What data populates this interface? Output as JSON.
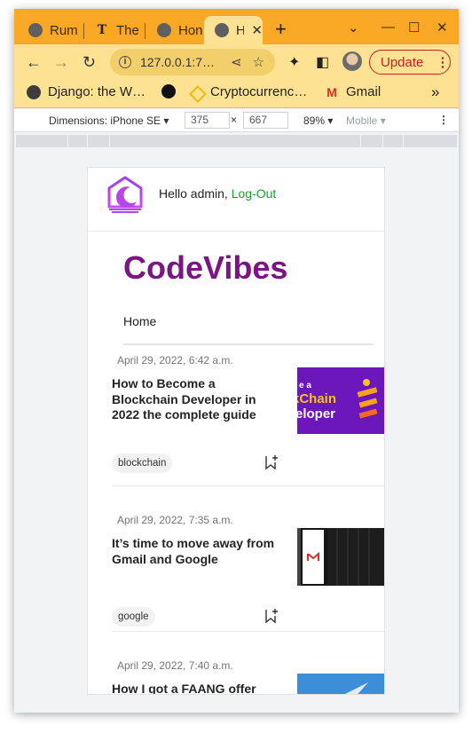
{
  "browser": {
    "tabs": [
      {
        "label": "Rum",
        "icon": "globe-icon"
      },
      {
        "label": "The",
        "icon": "nyt-icon"
      },
      {
        "label": "Hon",
        "icon": "globe-icon"
      },
      {
        "label": "H",
        "icon": "globe-icon",
        "active": true
      }
    ],
    "url": "127.0.0.1:7…",
    "update_label": "Update",
    "bookmarks": [
      {
        "label": "Django: the W…",
        "icon": "globe-icon"
      },
      {
        "label": "",
        "icon": "github-icon"
      },
      {
        "label": "Cryptocurrenc…",
        "icon": "binance-icon"
      },
      {
        "label": "Gmail",
        "icon": "gmail-icon"
      }
    ]
  },
  "devtools": {
    "dimensions_label": "Dimensions: iPhone SE",
    "width": "375",
    "height": "667",
    "times": "×",
    "zoom": "89%",
    "mode": "Mobile"
  },
  "site": {
    "greeting": "Hello admin,",
    "logout_label": "Log-Out",
    "brand": "CodeVibes",
    "nav_home": "Home",
    "brand_color": "#7b1583",
    "link_color": "#1b9e2b"
  },
  "posts": [
    {
      "date": "April 29, 2022, 6:42 a.m.",
      "title": "How to Become a Blockchain Developer in 2022 the complete guide",
      "tag": "blockchain",
      "thumb_text_1": "e a",
      "thumb_text_2": "kChain",
      "thumb_text_3": "eloper"
    },
    {
      "date": "April 29, 2022, 7:35 a.m.",
      "title": "It’s time to move away from Gmail and Google",
      "tag": "google"
    },
    {
      "date": "April 29, 2022, 7:40 a.m.",
      "title": "How I got a FAANG offer"
    }
  ]
}
